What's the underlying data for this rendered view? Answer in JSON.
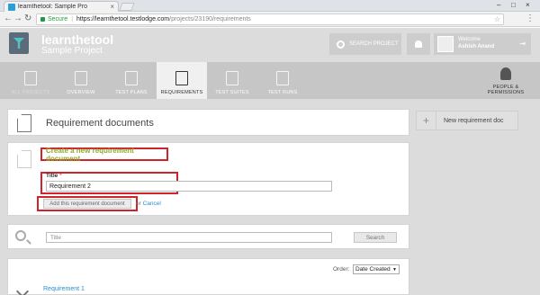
{
  "browser": {
    "tab_title": "learnthetool: Sample Pro",
    "tab_close": "×",
    "secure_label": "Secure",
    "url_host": "https://learnthetool.testlodge.com",
    "url_path": "/projects/23190/requirements",
    "window_controls": [
      "–",
      "□",
      "×"
    ]
  },
  "header": {
    "brand": "learnthetool",
    "project": "Sample Project",
    "search_label": "SEARCH PROJECT",
    "welcome": "Welcome",
    "user_name": "Ashish Anand"
  },
  "nav": {
    "items": [
      {
        "label": "ALL PROJECTS",
        "icon": "folder-icon"
      },
      {
        "label": "OVERVIEW",
        "icon": "monitor-icon"
      },
      {
        "label": "TEST PLANS",
        "icon": "clipboard-icon"
      },
      {
        "label": "REQUIREMENTS",
        "icon": "document-icon",
        "active": true
      },
      {
        "label": "TEST SUITES",
        "icon": "list-icon"
      },
      {
        "label": "TEST RUNS",
        "icon": "checklist-icon"
      }
    ],
    "people_label_1": "PEOPLE &",
    "people_label_2": "PERMISSIONS"
  },
  "main": {
    "page_title": "Requirement documents",
    "new_doc_button": "New requirement doc",
    "new_doc_plus": "+",
    "create_link": "Create a new requirement document",
    "title_label": "Title",
    "title_required": "*",
    "title_value": "Requirement 2",
    "add_button": "Add this requirement document",
    "or_text": "or",
    "cancel_text": "Cancel",
    "search_placeholder": "Title",
    "search_button": "Search",
    "order_label": "Order:",
    "order_value": "Date Created",
    "requirement_link": "Requirement 1"
  }
}
